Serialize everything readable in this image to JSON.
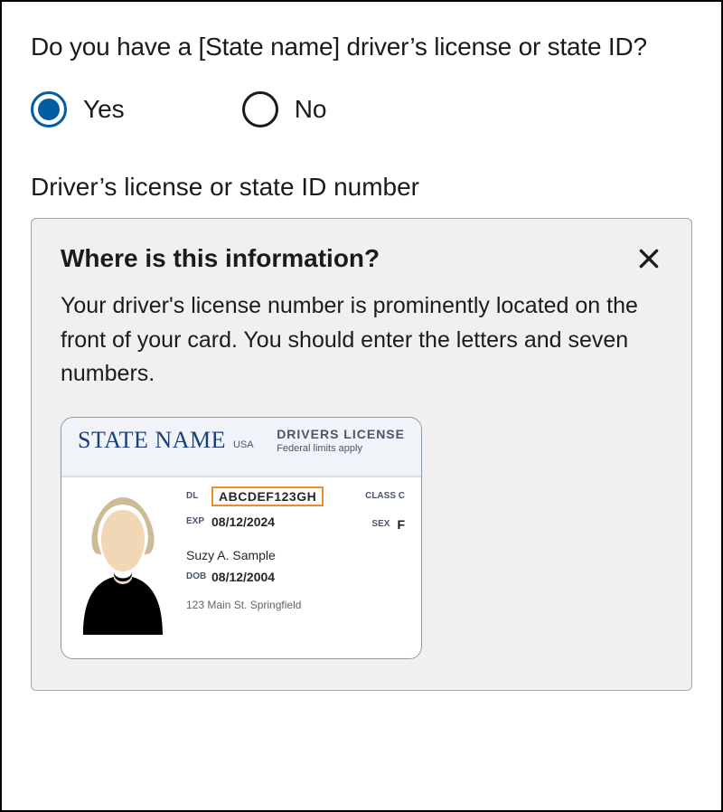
{
  "question": "Do you have a [State name] driver’s license or state ID?",
  "options": {
    "yes": "Yes",
    "no": "No"
  },
  "field_label": "Driver’s license or state ID number",
  "help": {
    "title": "Where is this information?",
    "body": "Your driver's license number is prominently located on the front of your card. You should enter the letters and seven numbers."
  },
  "card": {
    "state_name": "STATE NAME",
    "usa": "USA",
    "dl_title": "DRIVERS LICENSE",
    "federal": "Federal limits apply",
    "dl_label": "DL",
    "dl_value": "ABCDEF123GH",
    "exp_label": "EXP",
    "exp_value": "08/12/2024",
    "class_label": "CLASS C",
    "sex_label": "SEX",
    "sex_value": "F",
    "name": "Suzy A. Sample",
    "dob_label": "DOB",
    "dob_value": "08/12/2004",
    "address": "123 Main St. Springfield"
  }
}
